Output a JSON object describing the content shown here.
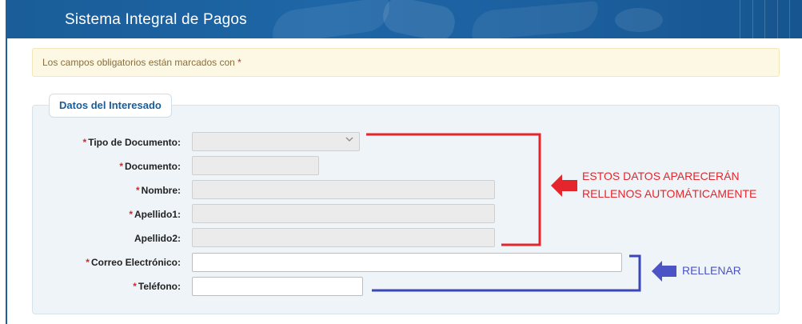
{
  "header": {
    "title": "Sistema Integral de Pagos"
  },
  "notice": {
    "text": "Los campos obligatorios están marcados con ",
    "required_mark": "*"
  },
  "section": {
    "legend": "Datos del Interesado"
  },
  "form": {
    "fields": [
      {
        "label": "Tipo de Documento:",
        "required": "*",
        "value": ""
      },
      {
        "label": "Documento:",
        "required": "*",
        "value": ""
      },
      {
        "label": "Nombre:",
        "required": "*",
        "value": ""
      },
      {
        "label": "Apellido1:",
        "required": "*",
        "value": ""
      },
      {
        "label": "Apellido2:",
        "required": "",
        "value": ""
      },
      {
        "label": "Correo Electrónico:",
        "required": "*",
        "value": ""
      },
      {
        "label": "Teléfono:",
        "required": "*",
        "value": ""
      }
    ]
  },
  "annotations": {
    "auto_line1": "ESTOS DATOS APARECERÁN",
    "auto_line2": "RELLENOS AUTOMÁTICAMENTE",
    "fill": "RELLENAR"
  },
  "colors": {
    "header": "#1d62a3",
    "red_annotation": "#e4262c",
    "blue_annotation": "#4b53c5",
    "required": "#e02424"
  },
  "icons": {
    "select": "chevron-down-icon",
    "red_arrow": "arrow-left-icon",
    "blue_arrow": "arrow-left-icon"
  }
}
